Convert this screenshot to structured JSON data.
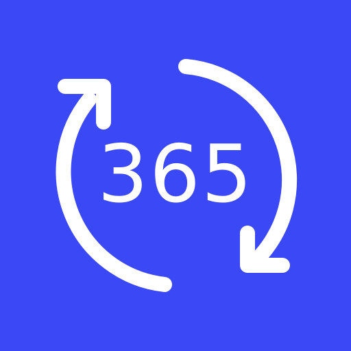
{
  "icon": {
    "number_text": "365",
    "symbol": "refresh-cycle-icon",
    "colors": {
      "background": "#3B48F6",
      "foreground": "#FFFFFF"
    }
  }
}
